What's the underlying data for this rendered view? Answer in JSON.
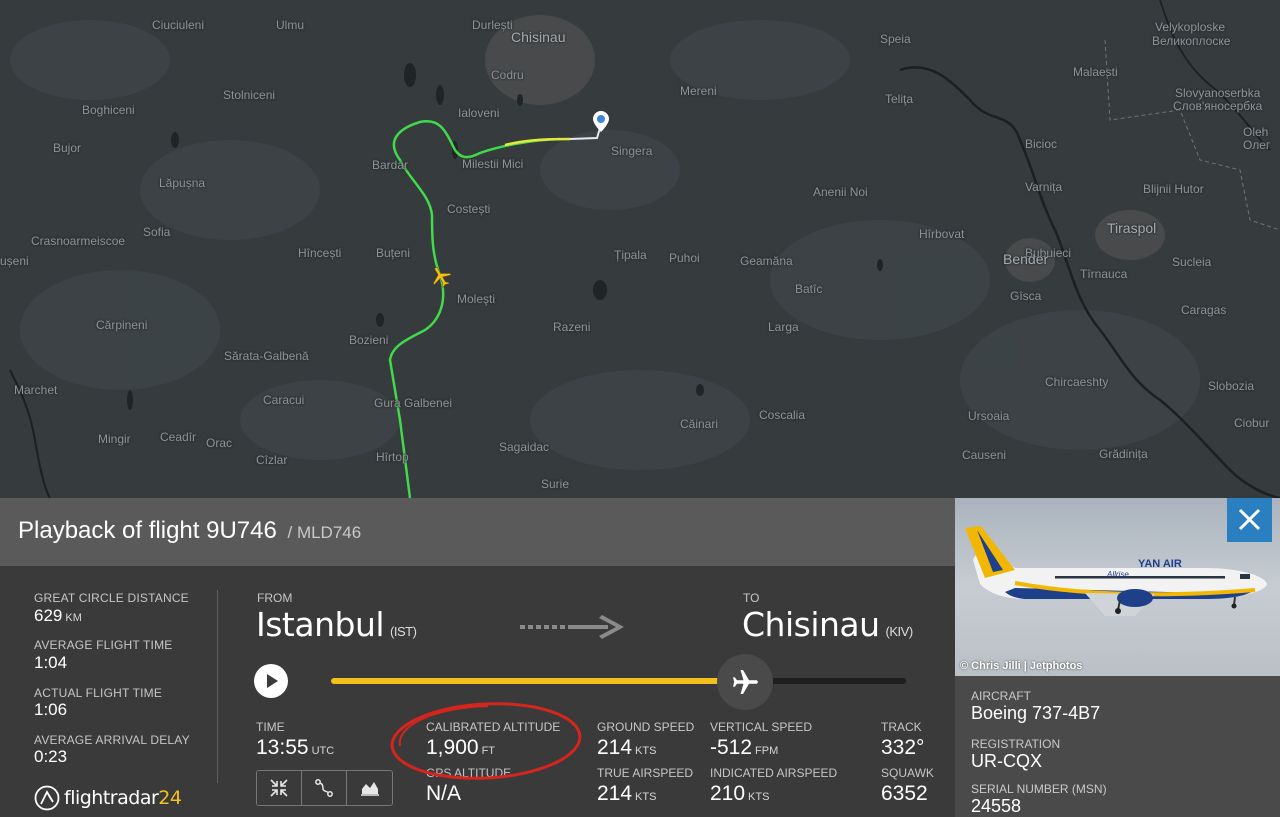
{
  "map": {
    "places": [
      {
        "name": "Ciuciuleni",
        "cls": ""
      },
      {
        "name": "Ulmu",
        "cls": ""
      },
      {
        "name": "Durlești",
        "cls": ""
      },
      {
        "name": "Chisinau",
        "cls": "mid"
      },
      {
        "name": "Speia",
        "cls": ""
      },
      {
        "name": "Velykoploske",
        "cls": ""
      },
      {
        "name": "Великоплоске",
        "cls": ""
      },
      {
        "name": "Codru",
        "cls": ""
      },
      {
        "name": "Malaesti",
        "cls": ""
      },
      {
        "name": "Mereni",
        "cls": ""
      },
      {
        "name": "Slovyanoserbka",
        "cls": ""
      },
      {
        "name": "Слов'яносербка",
        "cls": ""
      },
      {
        "name": "Boghiceni",
        "cls": ""
      },
      {
        "name": "Stolniceni",
        "cls": ""
      },
      {
        "name": "Ialoveni",
        "cls": ""
      },
      {
        "name": "Teliţa",
        "cls": ""
      },
      {
        "name": "Oleh",
        "cls": ""
      },
      {
        "name": "Олег",
        "cls": ""
      },
      {
        "name": "Bujor",
        "cls": ""
      },
      {
        "name": "Singera",
        "cls": ""
      },
      {
        "name": "Bicioc",
        "cls": ""
      },
      {
        "name": "Bardar",
        "cls": ""
      },
      {
        "name": "Milestii Mici",
        "cls": ""
      },
      {
        "name": "Lăpușna",
        "cls": ""
      },
      {
        "name": "Varnița",
        "cls": ""
      },
      {
        "name": "Blijnii Hutor",
        "cls": ""
      },
      {
        "name": "Anenii Noi",
        "cls": ""
      },
      {
        "name": "Costești",
        "cls": ""
      },
      {
        "name": "Sofia",
        "cls": ""
      },
      {
        "name": "Crasnoarmeiscoe",
        "cls": ""
      },
      {
        "name": "Hîrbovat",
        "cls": ""
      },
      {
        "name": "Tiraspol",
        "cls": "mid"
      },
      {
        "name": "Hîncești",
        "cls": ""
      },
      {
        "name": "Bubuieci",
        "cls": ""
      },
      {
        "name": "Buțeni",
        "cls": ""
      },
      {
        "name": "Țipala",
        "cls": ""
      },
      {
        "name": "Puhoi",
        "cls": ""
      },
      {
        "name": "Geamăna",
        "cls": ""
      },
      {
        "name": "Bender",
        "cls": "mid"
      },
      {
        "name": "Tîrnauca",
        "cls": ""
      },
      {
        "name": "Sucleia",
        "cls": ""
      },
      {
        "name": "ușeni",
        "cls": ""
      },
      {
        "name": "Batîc",
        "cls": ""
      },
      {
        "name": "Gîsca",
        "cls": ""
      },
      {
        "name": "Moleşti",
        "cls": ""
      },
      {
        "name": "Caragas",
        "cls": ""
      },
      {
        "name": "Cărpineni",
        "cls": ""
      },
      {
        "name": "Razeni",
        "cls": ""
      },
      {
        "name": "Larga",
        "cls": ""
      },
      {
        "name": "Bozieni",
        "cls": ""
      },
      {
        "name": "Sărata-Galbenă",
        "cls": ""
      },
      {
        "name": "Chircaeshty",
        "cls": ""
      },
      {
        "name": "Slobozia",
        "cls": ""
      },
      {
        "name": "Marchet",
        "cls": ""
      },
      {
        "name": "Caracui",
        "cls": ""
      },
      {
        "name": "Gura Galbenei",
        "cls": ""
      },
      {
        "name": "Coscalia",
        "cls": ""
      },
      {
        "name": "Ursoaia",
        "cls": ""
      },
      {
        "name": "Căinari",
        "cls": ""
      },
      {
        "name": "Ciobur",
        "cls": ""
      },
      {
        "name": "Mingir",
        "cls": ""
      },
      {
        "name": "Ceadîr",
        "cls": ""
      },
      {
        "name": "Orac",
        "cls": ""
      },
      {
        "name": "Sagaidac",
        "cls": ""
      },
      {
        "name": "Causeni",
        "cls": ""
      },
      {
        "name": "Grădinița",
        "cls": ""
      },
      {
        "name": "Cîzlar",
        "cls": ""
      },
      {
        "name": "Hîrtop",
        "cls": ""
      },
      {
        "name": "Surie",
        "cls": ""
      }
    ],
    "colors": {
      "track_green": "#42d94a",
      "track_yellow": "#e5e83c",
      "plane": "#f4c11a",
      "marker": "#3c86d8"
    },
    "icons": {
      "plane": "airplane-icon",
      "destination": "location-pin-icon"
    }
  },
  "flight": {
    "title": "Playback of flight 9U746",
    "callsign": "/ MLD746"
  },
  "stats": {
    "great_circle_label": "Great Circle Distance",
    "great_circle_value": "629",
    "great_circle_unit": "KM",
    "avg_time_label": "Average Flight Time",
    "avg_time_value": "1:04",
    "actual_time_label": "Actual Flight Time",
    "actual_time_value": "1:06",
    "delay_label": "Average Arrival Delay",
    "delay_value": "0:23"
  },
  "route": {
    "from_label": "FROM",
    "from_city": "Istanbul",
    "from_code": "(IST)",
    "to_label": "TO",
    "to_city": "Chisinau",
    "to_code": "(KIV)"
  },
  "playback": {
    "progress_fraction": 0.72,
    "icons": [
      "play-icon",
      "airplane-icon"
    ]
  },
  "details": {
    "time_label": "TIME",
    "time_value": "13:55",
    "time_unit": "UTC",
    "cal_alt_label": "CALIBRATED ALTITUDE",
    "cal_alt_value": "1,900",
    "cal_alt_unit": "FT",
    "gps_alt_label": "GPS ALTITUDE",
    "gps_alt_value": "N/A",
    "ground_speed_label": "GROUND SPEED",
    "ground_speed_value": "214",
    "ground_speed_unit": "KTS",
    "true_airspeed_label": "TRUE AIRSPEED",
    "true_airspeed_value": "214",
    "true_airspeed_unit": "KTS",
    "vertical_speed_label": "VERTICAL SPEED",
    "vertical_speed_value": "-512",
    "vertical_speed_unit": "FPM",
    "indicated_airspeed_label": "INDICATED AIRSPEED",
    "indicated_airspeed_value": "210",
    "indicated_airspeed_unit": "KTS",
    "track_label": "TRACK",
    "track_value": "332°",
    "squawk_label": "SQUAWK",
    "squawk_value": "6352"
  },
  "tools": {
    "icons": [
      "compress-icon",
      "route-icon",
      "chart-icon"
    ]
  },
  "brand": {
    "name": "flightradar",
    "num": "24"
  },
  "aircraft": {
    "photo_credit": "© Chris Jilli | Jetphotos",
    "livery_brand": "YAN AIR",
    "livery_script": "Allrise",
    "aircraft_label": "AIRCRAFT",
    "aircraft_value": "Boeing 737-4B7",
    "registration_label": "REGISTRATION",
    "registration_value": "UR-CQX",
    "msn_label": "SERIAL NUMBER (MSN)",
    "msn_value": "24558"
  },
  "colors": {
    "accent_yellow": "#f4c11a",
    "close_blue": "#2a7fc1",
    "annotation_red": "#d5251d"
  }
}
